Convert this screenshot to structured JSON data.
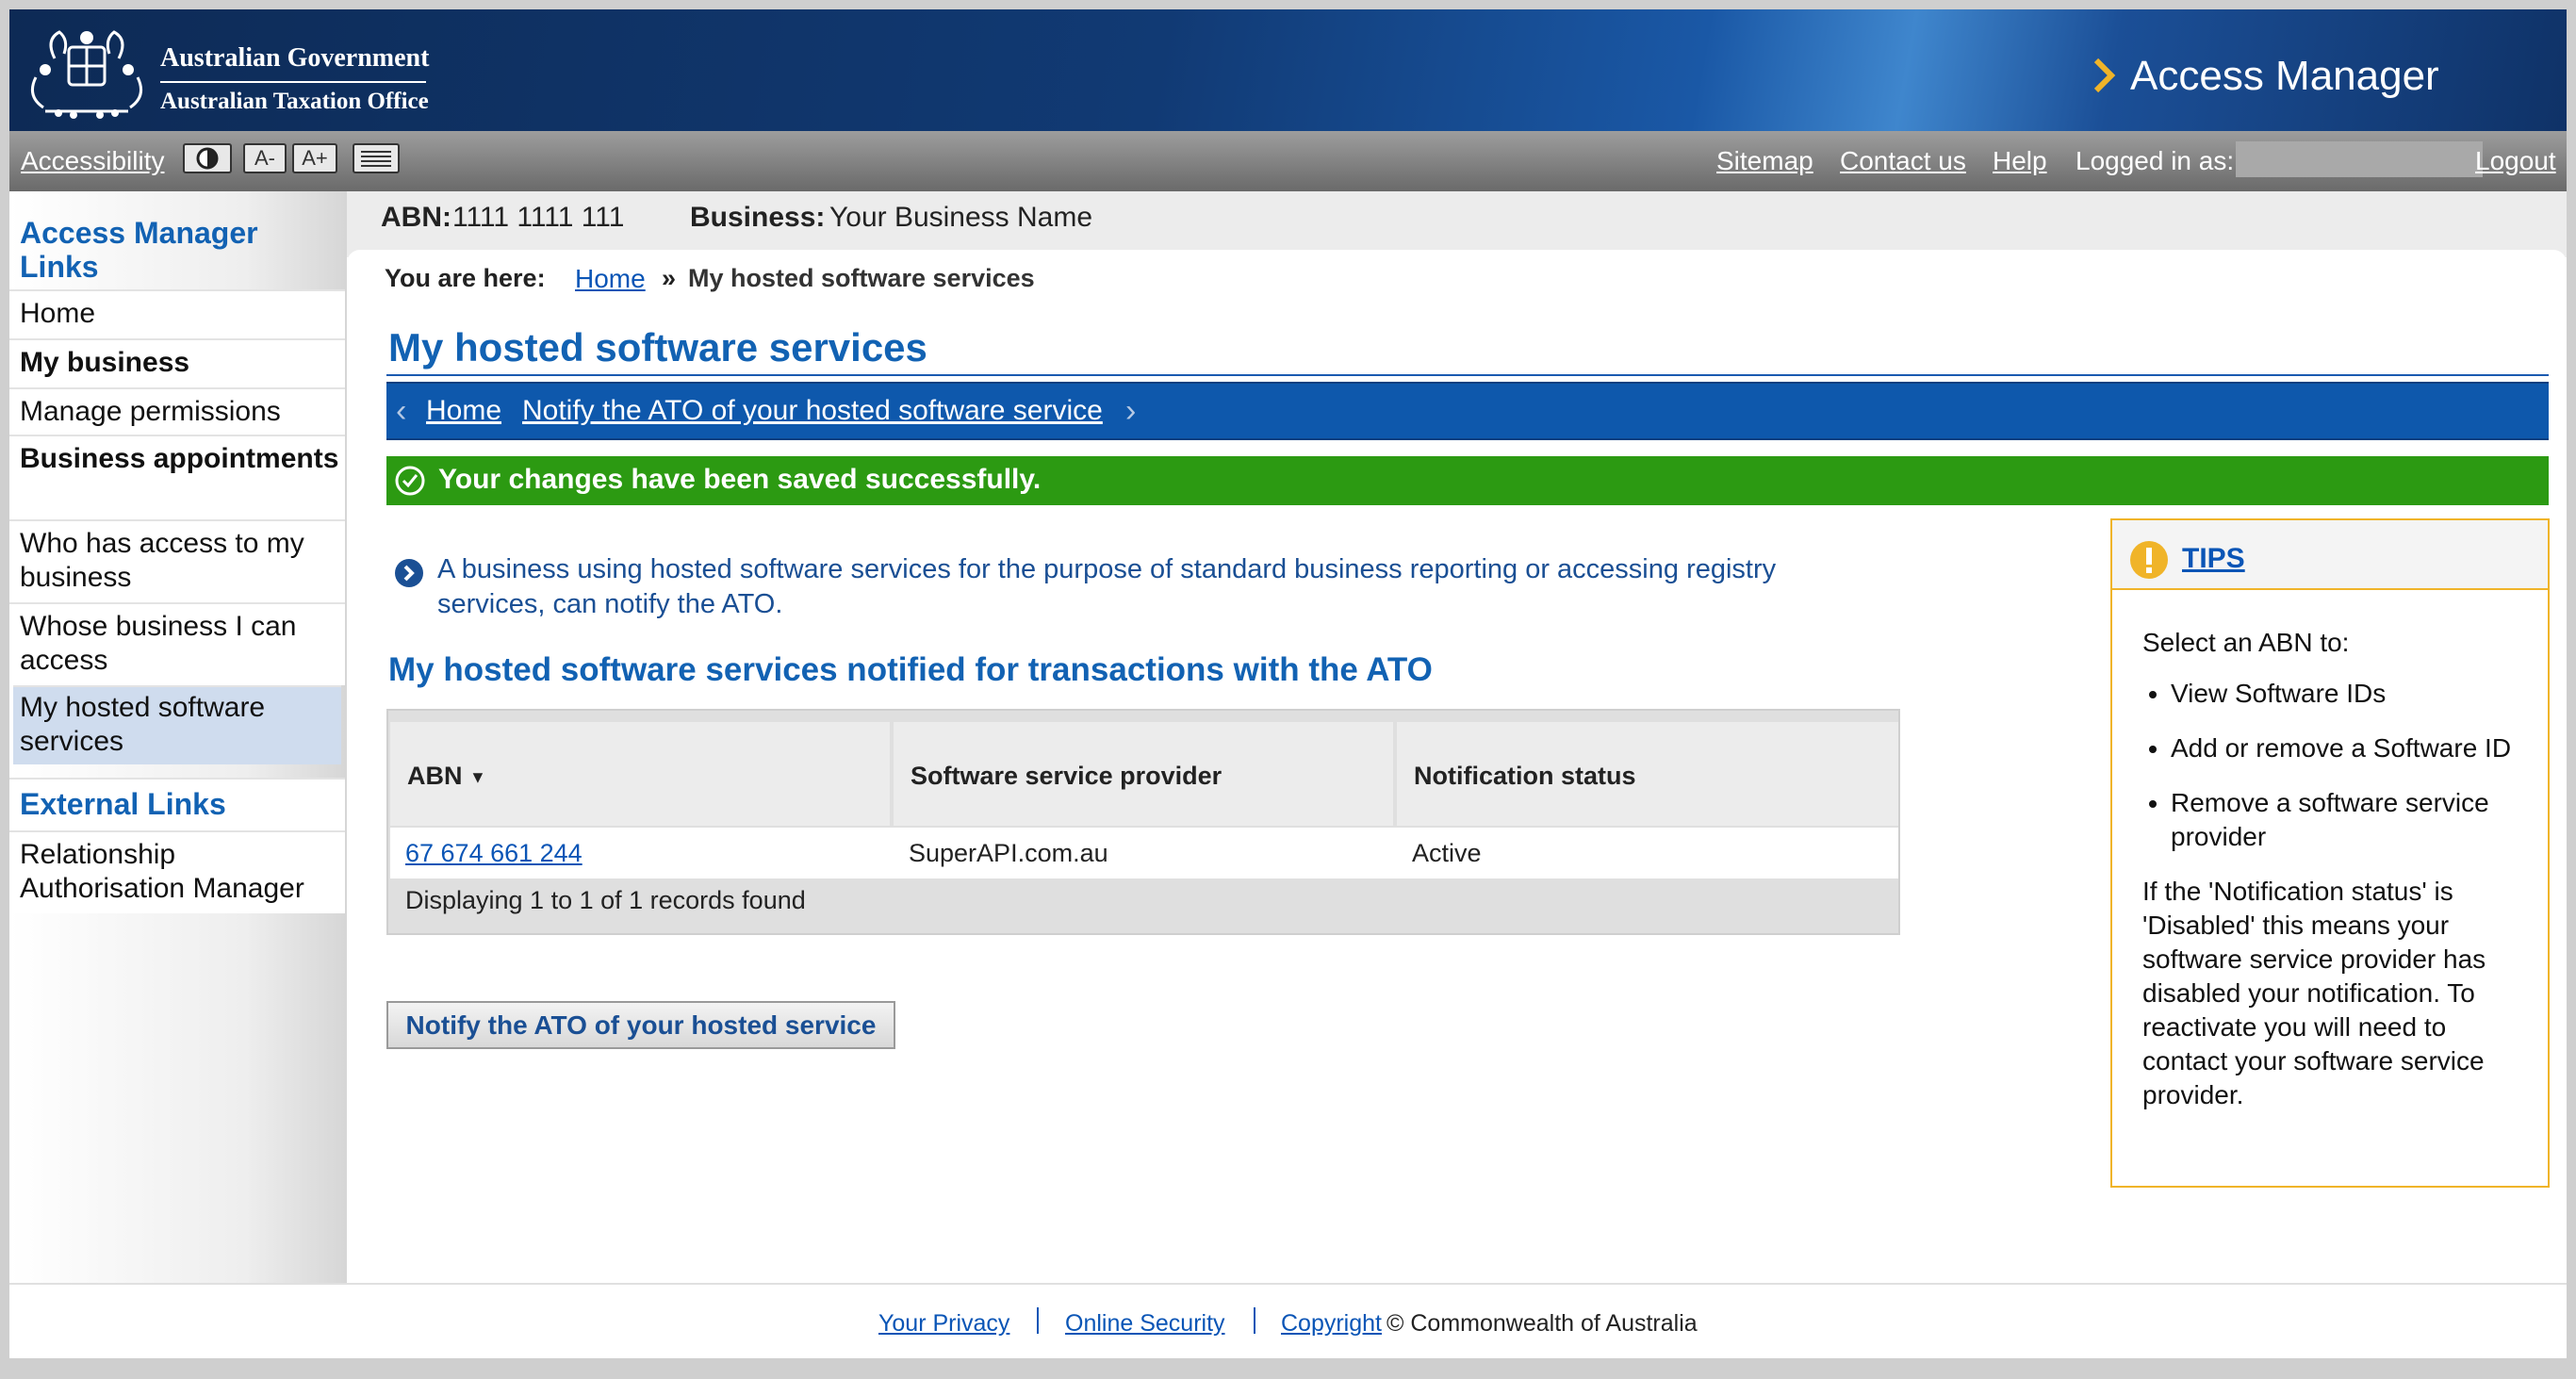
{
  "header": {
    "gov_line1": "Australian Government",
    "gov_line2": "Australian Taxation Office",
    "app_title": "Access Manager"
  },
  "toolbar": {
    "accessibility": "Accessibility",
    "contrast_icon": "contrast-icon",
    "font_decrease": "A-",
    "font_increase": "A+",
    "print_icon": "print-icon",
    "sitemap": "Sitemap",
    "contact": "Contact us",
    "help": "Help",
    "logged_in_as": "Logged in as:",
    "logout": "Logout"
  },
  "sidebar": {
    "heading": "Access Manager Links",
    "items": [
      "Home",
      "My business",
      "Manage permissions",
      "Business appointments",
      "Who has access to my business",
      "Whose business I can access",
      "My hosted software services"
    ],
    "external_heading": "External Links",
    "external_items": [
      "Relationship Authorisation Manager"
    ]
  },
  "context": {
    "abn_label": "ABN:",
    "abn_value": "1111 1111 111",
    "business_label": "Business:",
    "business_value": "Your Business Name"
  },
  "breadcrumb": {
    "label": "You are here:",
    "home": "Home",
    "separator": "»",
    "current": "My hosted software services"
  },
  "page": {
    "title": "My hosted software services",
    "subnav_home": "Home",
    "subnav_link": "Notify the ATO of your hosted software service",
    "success": "Your changes have been saved successfully.",
    "info": "A business using hosted software services for the purpose of standard business reporting or accessing registry services, can notify the ATO.",
    "section_heading": "My hosted software services notified for transactions with the ATO",
    "notify_button": "Notify the ATO of your hosted service"
  },
  "table": {
    "columns": [
      "ABN",
      "Software service provider",
      "Notification status"
    ],
    "sort_indicator": "▼",
    "rows": [
      {
        "abn": "67 674 661 244",
        "provider": "SuperAPI.com.au",
        "status": "Active"
      }
    ],
    "records": "Displaying 1 to 1 of 1 records found"
  },
  "tips": {
    "title": "TIPS",
    "intro": "Select an ABN to:",
    "bullets": [
      "View Software IDs",
      "Add or remove a Software ID",
      "Remove a software service provider"
    ],
    "note": "If the 'Notification status' is 'Disabled' this means your software service provider has disabled your notification. To reactivate you will need to contact your software service provider."
  },
  "footer": {
    "privacy": "Your Privacy",
    "security": "Online Security",
    "copyright": "Copyright",
    "copyright_text": "© Commonwealth of Australia"
  },
  "colors": {
    "header_dark": "#0d2a55",
    "brand_blue": "#1262b3",
    "subnav_blue": "#0e58ac",
    "success_green": "#2c9a12",
    "tips_border": "#f0b429",
    "link_blue": "#0a55b6"
  }
}
